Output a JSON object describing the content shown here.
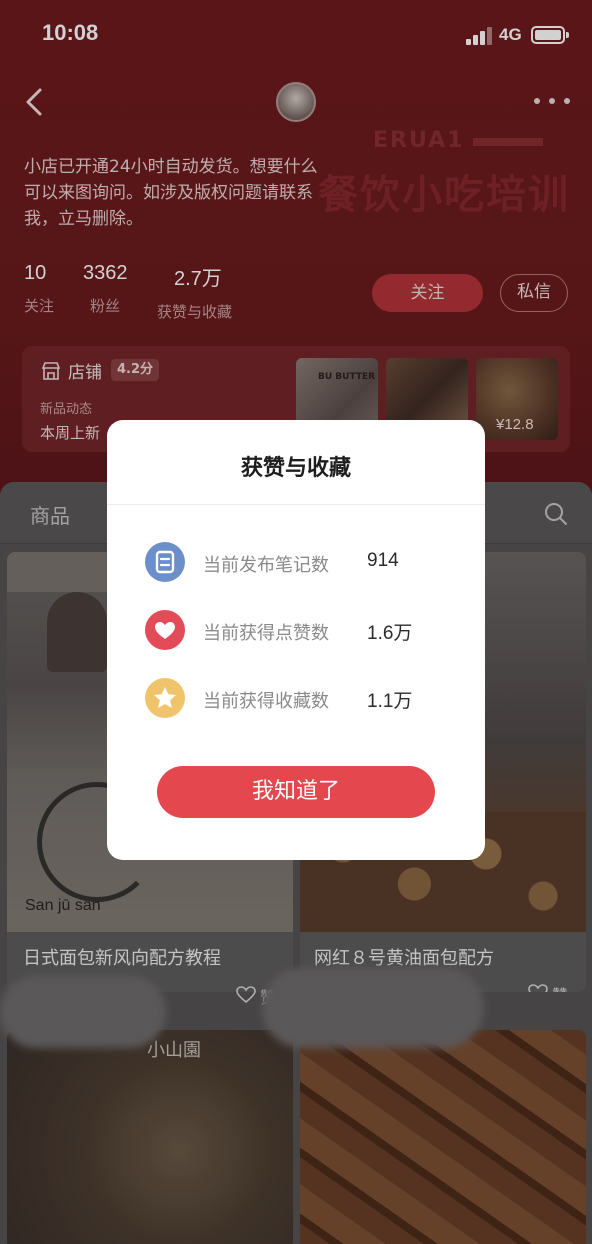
{
  "status_bar": {
    "time": "10:08",
    "network": "4G"
  },
  "profile": {
    "bio": "小店已开通24小时自动发货。想要什么可以来图询问。如涉及版权问题请联系我，立马删除。",
    "stats": [
      {
        "value": "10",
        "label": "关注"
      },
      {
        "value": "3362",
        "label": "粉丝"
      },
      {
        "value": "2.7万",
        "label": "获赞与收藏"
      }
    ],
    "follow_label": "关注",
    "message_label": "私信",
    "background_text": {
      "latin": "ERUA1",
      "chinese": "餐饮小吃培训"
    }
  },
  "shop": {
    "title": "店铺",
    "score": "4.2分",
    "subtitle": "新品动态",
    "new_text": "本周上新",
    "thumbnail_price": "¥12.8",
    "thumbnail_text": "BU BUTTER"
  },
  "content": {
    "tab_label": "商品",
    "cards": [
      {
        "title": "日式面包新风向配方教程",
        "like_label": "赞",
        "overlay_text": "San jū san"
      },
      {
        "title": "网红８号黄油面包配方",
        "like_label": "赞"
      },
      {
        "overlay_text": "小山園"
      },
      {}
    ]
  },
  "modal": {
    "title": "获赞与收藏",
    "rows": [
      {
        "icon": "notes-icon",
        "label": "当前发布笔记数",
        "value": "914"
      },
      {
        "icon": "heart-icon",
        "label": "当前获得点赞数",
        "value": "1.6万"
      },
      {
        "icon": "star-icon",
        "label": "当前获得收藏数",
        "value": "1.1万"
      }
    ],
    "confirm_label": "我知道了"
  },
  "colors": {
    "profile_bg": "#6e1a1e",
    "accent_red": "#e5474f",
    "notes_blue": "#6b8fc8",
    "likes_red": "#e34b59",
    "collect_yellow": "#f0c46a"
  }
}
